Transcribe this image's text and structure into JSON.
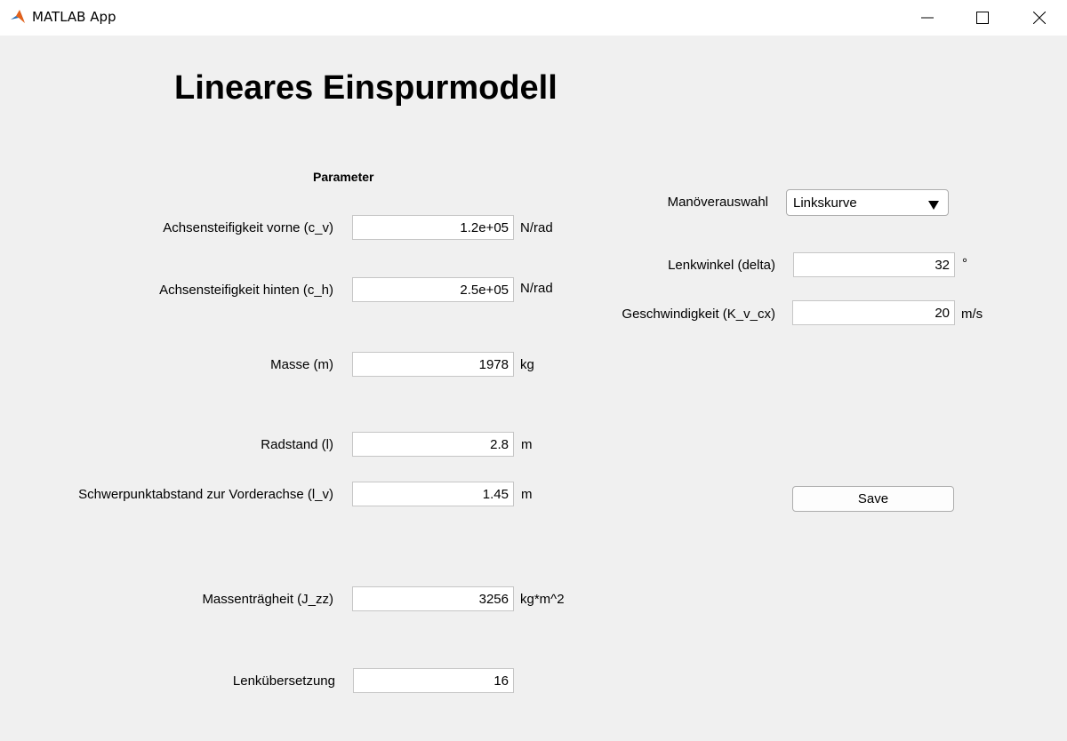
{
  "window": {
    "title": "MATLAB App",
    "icon": "matlab-logo-icon",
    "controls": [
      "minimize-icon",
      "maximize-icon",
      "close-icon"
    ]
  },
  "heading": "Lineares Einspurmodell",
  "parameters": {
    "section_title": "Parameter",
    "c_v": {
      "label": "Achsensteifigkeit vorne (c_v)",
      "value": "1.2e+05",
      "unit": "N/rad"
    },
    "c_h": {
      "label": "Achsensteifigkeit hinten (c_h)",
      "value": "2.5e+05",
      "unit": "N/rad"
    },
    "m": {
      "label": "Masse (m)",
      "value": "1978",
      "unit": "kg"
    },
    "l": {
      "label": "Radstand (l)",
      "value": "2.8",
      "unit": "m"
    },
    "l_v": {
      "label": "Schwerpunktabstand zur Vorderachse (l_v)",
      "value": "1.45",
      "unit": "m"
    },
    "J_zz": {
      "label": "Massenträgheit (J_zz)",
      "value": "3256",
      "unit": "kg*m^2"
    },
    "i_s": {
      "label": "Lenkübersetzung",
      "value": "16"
    }
  },
  "maneuver": {
    "select_label": "Manöverauswahl",
    "selected": "Linkskurve",
    "delta": {
      "label": "Lenkwinkel (delta)",
      "value": "32",
      "unit": "°"
    },
    "speed": {
      "label": "Geschwindigkeit (K_v_cx)",
      "value": "20",
      "unit": "m/s"
    },
    "save_label": "Save"
  },
  "colors": {
    "background": "#f0f0f0",
    "titlebar": "#ffffff",
    "field_border": "#c6c6c6"
  }
}
